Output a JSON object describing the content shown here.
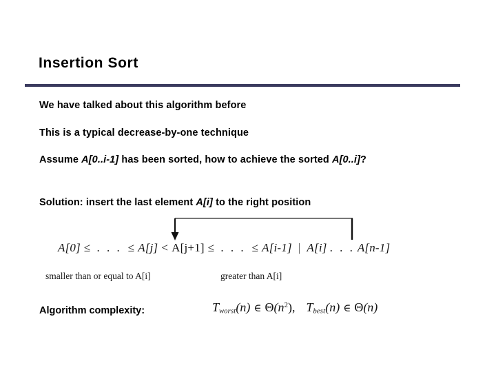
{
  "slide": {
    "title": "Insertion Sort",
    "accent_color": "#3a3a5e",
    "background_color": "#ffffff",
    "text_color": "#000000"
  },
  "bullets": [
    {
      "text": "We have talked about this algorithm before"
    },
    {
      "text": "This is a typical decrease-by-one technique"
    },
    {
      "pre": "Assume ",
      "code_a": "A[0..i-1]",
      "mid": " has been sorted, how to achieve the sorted ",
      "code_b": "A[0..i]",
      "post": "?"
    },
    {
      "pre": "Solution: insert the last element ",
      "code_a": "A[i]",
      "post": " to the right position"
    }
  ],
  "chain": {
    "terms": {
      "a0": "A[0]",
      "aj": "A[j]",
      "aj1": "A[j+1]",
      "ai_1": "A[i-1]",
      "ai": "A[i]",
      "an_1": "A[n-1]"
    },
    "symbols": {
      "leq": "≤",
      "lt": "<",
      "dots": ". . .",
      "pipe": "|"
    },
    "notes": {
      "left": "smaller than or equal to  A[i]",
      "right": "greater than  A[i]"
    },
    "arrow_label": "move-A[i]-left-arrow"
  },
  "complexity": {
    "label": "Algorithm complexity:",
    "worst": {
      "fn": "T",
      "sub": "worst",
      "arg": "(n)",
      "member": "∈",
      "theta": "Θ",
      "bound": "(n",
      "exp": "2",
      "close": "),"
    },
    "best": {
      "fn": "T",
      "sub": "best",
      "arg": "(n)",
      "member": "∈",
      "theta": "Θ",
      "bound": "(n)"
    },
    "formula_text": "T_worst(n) ∈ Θ(n²),  T_best(n) ∈ Θ(n)"
  }
}
